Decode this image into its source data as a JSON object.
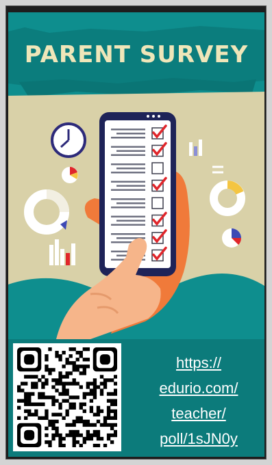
{
  "poster": {
    "title": "PARENT SURVEY",
    "colors": {
      "teal": "#0e8e8e",
      "beige": "#d9d1a8",
      "hand": "#f07a3a",
      "check_red": "#e0262b"
    },
    "checklist": [
      {
        "checked": true
      },
      {
        "checked": true
      },
      {
        "checked": false
      },
      {
        "checked": true
      },
      {
        "checked": false
      },
      {
        "checked": true
      },
      {
        "checked": true
      },
      {
        "checked": true
      }
    ],
    "icons": [
      "clock-icon",
      "pie-chart-icon",
      "donut-chart-icon",
      "bar-chart-icon",
      "phone-icon",
      "hand-icon"
    ]
  },
  "footer": {
    "link_lines": [
      "https://",
      "edurio.com/",
      "teacher/",
      "poll/1sJN0y"
    ],
    "qr_label": "qr-code"
  }
}
